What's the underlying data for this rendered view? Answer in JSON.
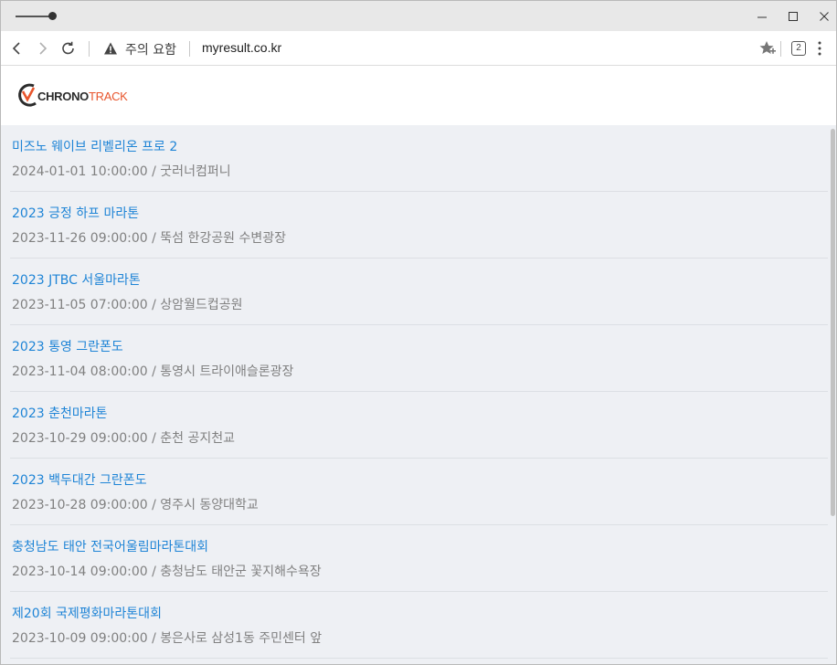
{
  "browser": {
    "security_warning": "주의 요함",
    "url": "myresult.co.kr",
    "tab_count": "2"
  },
  "logo": {
    "text_chrono": "CHRONO",
    "text_track": "TRACK",
    "brand_color": "#e8552c"
  },
  "colors": {
    "link": "#1e84d6",
    "meta": "#808080",
    "background": "#eef0f4"
  },
  "events": [
    {
      "title": "미즈노 웨이브 리벨리온 프로 2",
      "meta": "2024-01-01 10:00:00 / 굿러너컴퍼니"
    },
    {
      "title": "2023 긍정 하프 마라톤",
      "meta": "2023-11-26 09:00:00 / 뚝섬 한강공원 수변광장"
    },
    {
      "title": "2023 JTBC 서울마라톤",
      "meta": "2023-11-05 07:00:00 / 상암월드컵공원"
    },
    {
      "title": "2023 통영 그란폰도",
      "meta": "2023-11-04 08:00:00 / 통영시 트라이애슬론광장"
    },
    {
      "title": "2023 춘천마라톤",
      "meta": "2023-10-29 09:00:00 / 춘천 공지천교"
    },
    {
      "title": "2023 백두대간 그란폰도",
      "meta": "2023-10-28 09:00:00 / 영주시 동양대학교"
    },
    {
      "title": "충청남도 태안 전국어울림마라톤대회",
      "meta": "2023-10-14 09:00:00 / 충청남도 태안군 꽃지해수욕장"
    },
    {
      "title": "제20회 국제평화마라톤대회",
      "meta": "2023-10-09 09:00:00 / 봉은사로 삼성1동 주민센터 앞"
    }
  ]
}
